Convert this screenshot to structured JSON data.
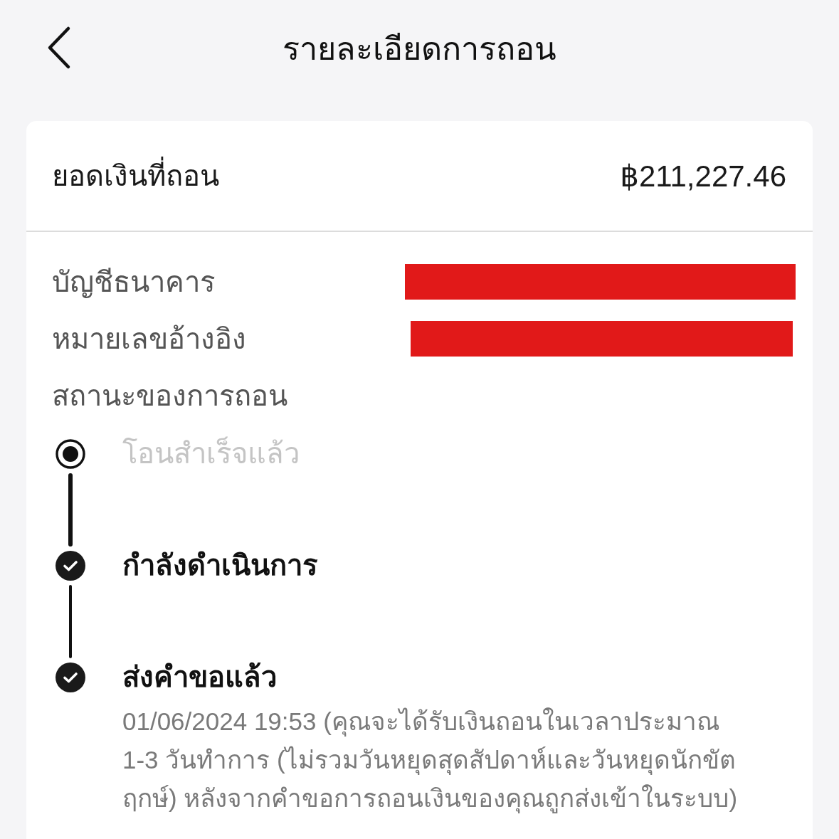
{
  "header": {
    "title": "รายละเอียดการถอน"
  },
  "amount": {
    "label": "ยอดเงินที่ถอน",
    "value": "฿211,227.46"
  },
  "details": [
    {
      "label": "บัญชีธนาคาร",
      "redacted": true
    },
    {
      "label": "หมายเลขอ้างอิง",
      "redacted": true
    }
  ],
  "status": {
    "label": "สถานะของการถอน",
    "steps": [
      {
        "label": "โอนสำเร็จแล้ว",
        "done": false
      },
      {
        "label": "กำลังดำเนินการ",
        "done": true
      },
      {
        "label": "ส่งคำขอแล้ว",
        "done": true,
        "note": "01/06/2024 19:53 (คุณจะได้รับเงินถอนในเวลาประมาณ 1-3 วันทำการ (ไม่รวมวันหยุดสุดสัปดาห์และวันหยุดนักขัตฤกษ์) หลังจากคำขอการถอนเงินของคุณถูกส่งเข้าในระบบ)"
      }
    ]
  }
}
